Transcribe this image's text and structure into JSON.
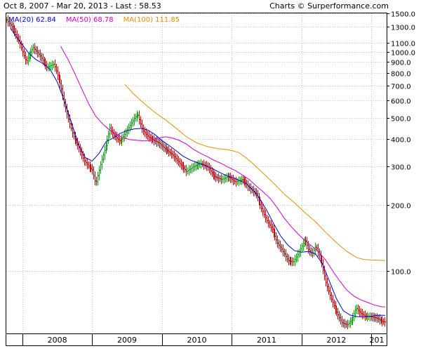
{
  "header": {
    "range_text": "Oct 8, 2007 - Mar 20, 2013 - Last : 58.53",
    "credit_text": "Charts © Surperformance.com"
  },
  "chart_data": {
    "type": "ohlc-weekly-bars-with-moving-averages",
    "title": "Oct 8, 2007 - Mar 20, 2013 - Last : 58.53",
    "y_scale": "log",
    "ylim": [
      52,
      1500
    ],
    "y_ticks": [
      1500,
      1300,
      1100,
      1000,
      900,
      800,
      700,
      600,
      500,
      400,
      300,
      200,
      100
    ],
    "y_tick_labels": [
      "1500.0",
      "1300.0",
      "1100.0",
      "1000.0",
      "900.0",
      "800.0",
      "700.0",
      "600.0",
      "500.0",
      "400.0",
      "300.0",
      "200.0",
      "100.0"
    ],
    "x_labels": [
      "2008",
      "2009",
      "2010",
      "2011",
      "2012",
      "201"
    ],
    "x_label_dates": [
      2008.0,
      2009.0,
      2010.0,
      2011.0,
      2012.0,
      2013.0
    ],
    "x_range": [
      2007.77,
      2013.22
    ],
    "grid": true,
    "legend": [
      {
        "name": "MA(20)",
        "value": "62.84",
        "color": "#0000cc"
      },
      {
        "name": "MA(50)",
        "value": "68.78",
        "color": "#cc00cc"
      },
      {
        "name": "MA(100)",
        "value": "111.85",
        "color": "#e09000"
      }
    ],
    "price_path": [
      [
        2007.77,
        1400
      ],
      [
        2007.85,
        1300
      ],
      [
        2007.95,
        1120
      ],
      [
        2008.05,
        900
      ],
      [
        2008.15,
        1050
      ],
      [
        2008.25,
        960
      ],
      [
        2008.35,
        850
      ],
      [
        2008.45,
        880
      ],
      [
        2008.55,
        700
      ],
      [
        2008.6,
        580
      ],
      [
        2008.65,
        500
      ],
      [
        2008.72,
        420
      ],
      [
        2008.8,
        370
      ],
      [
        2008.88,
        320
      ],
      [
        2008.95,
        300
      ],
      [
        2009.0,
        290
      ],
      [
        2009.05,
        250
      ],
      [
        2009.12,
        310
      ],
      [
        2009.2,
        380
      ],
      [
        2009.25,
        450
      ],
      [
        2009.3,
        420
      ],
      [
        2009.4,
        390
      ],
      [
        2009.5,
        440
      ],
      [
        2009.6,
        500
      ],
      [
        2009.65,
        520
      ],
      [
        2009.72,
        440
      ],
      [
        2009.8,
        410
      ],
      [
        2009.88,
        395
      ],
      [
        2009.95,
        385
      ],
      [
        2010.05,
        360
      ],
      [
        2010.15,
        340
      ],
      [
        2010.25,
        310
      ],
      [
        2010.35,
        285
      ],
      [
        2010.45,
        300
      ],
      [
        2010.55,
        310
      ],
      [
        2010.65,
        300
      ],
      [
        2010.75,
        270
      ],
      [
        2010.85,
        262
      ],
      [
        2010.95,
        270
      ],
      [
        2011.05,
        255
      ],
      [
        2011.15,
        262
      ],
      [
        2011.25,
        240
      ],
      [
        2011.35,
        225
      ],
      [
        2011.42,
        195
      ],
      [
        2011.5,
        170
      ],
      [
        2011.58,
        155
      ],
      [
        2011.65,
        135
      ],
      [
        2011.72,
        125
      ],
      [
        2011.8,
        112
      ],
      [
        2011.88,
        110
      ],
      [
        2011.95,
        120
      ],
      [
        2012.0,
        130
      ],
      [
        2012.05,
        140
      ],
      [
        2012.1,
        125
      ],
      [
        2012.15,
        120
      ],
      [
        2012.2,
        130
      ],
      [
        2012.28,
        112
      ],
      [
        2012.35,
        88
      ],
      [
        2012.42,
        75
      ],
      [
        2012.5,
        65
      ],
      [
        2012.58,
        58
      ],
      [
        2012.65,
        57
      ],
      [
        2012.72,
        60
      ],
      [
        2012.78,
        68
      ],
      [
        2012.85,
        64
      ],
      [
        2012.92,
        62
      ],
      [
        2013.0,
        62
      ],
      [
        2013.08,
        61
      ],
      [
        2013.15,
        59
      ],
      [
        2013.21,
        58.53
      ]
    ],
    "series": [
      {
        "name": "MA(20)",
        "values": [
          [
            2007.83,
            1280
          ],
          [
            2007.95,
            1130
          ],
          [
            2008.1,
            980
          ],
          [
            2008.2,
            920
          ],
          [
            2008.3,
            885
          ],
          [
            2008.4,
            830
          ],
          [
            2008.5,
            730
          ],
          [
            2008.6,
            600
          ],
          [
            2008.7,
            480
          ],
          [
            2008.8,
            380
          ],
          [
            2008.9,
            330
          ],
          [
            2009.0,
            318
          ],
          [
            2009.1,
            345
          ],
          [
            2009.2,
            390
          ],
          [
            2009.3,
            405
          ],
          [
            2009.4,
            425
          ],
          [
            2009.5,
            438
          ],
          [
            2009.6,
            445
          ],
          [
            2009.7,
            448
          ],
          [
            2009.8,
            440
          ],
          [
            2009.9,
            420
          ],
          [
            2010.0,
            395
          ],
          [
            2010.1,
            375
          ],
          [
            2010.2,
            355
          ],
          [
            2010.3,
            335
          ],
          [
            2010.4,
            322
          ],
          [
            2010.5,
            313
          ],
          [
            2010.6,
            305
          ],
          [
            2010.7,
            296
          ],
          [
            2010.8,
            285
          ],
          [
            2010.9,
            275
          ],
          [
            2011.0,
            268
          ],
          [
            2011.1,
            260
          ],
          [
            2011.2,
            252
          ],
          [
            2011.3,
            235
          ],
          [
            2011.4,
            215
          ],
          [
            2011.5,
            190
          ],
          [
            2011.6,
            165
          ],
          [
            2011.7,
            145
          ],
          [
            2011.8,
            132
          ],
          [
            2011.9,
            124
          ],
          [
            2012.0,
            122
          ],
          [
            2012.1,
            123
          ],
          [
            2012.2,
            120
          ],
          [
            2012.3,
            108
          ],
          [
            2012.4,
            90
          ],
          [
            2012.5,
            75
          ],
          [
            2012.6,
            66
          ],
          [
            2012.7,
            63
          ],
          [
            2012.8,
            62
          ],
          [
            2012.9,
            62
          ],
          [
            2013.0,
            62.3
          ],
          [
            2013.1,
            63
          ],
          [
            2013.2,
            62.84
          ]
        ]
      },
      {
        "name": "MA(50)",
        "values": [
          [
            2008.55,
            1060
          ],
          [
            2008.65,
            930
          ],
          [
            2008.75,
            800
          ],
          [
            2008.85,
            680
          ],
          [
            2008.95,
            580
          ],
          [
            2009.05,
            510
          ],
          [
            2009.15,
            470
          ],
          [
            2009.25,
            440
          ],
          [
            2009.35,
            420
          ],
          [
            2009.45,
            405
          ],
          [
            2009.55,
            398
          ],
          [
            2009.65,
            395
          ],
          [
            2009.75,
            393
          ],
          [
            2009.85,
            396
          ],
          [
            2009.95,
            405
          ],
          [
            2010.05,
            410
          ],
          [
            2010.15,
            405
          ],
          [
            2010.25,
            395
          ],
          [
            2010.35,
            380
          ],
          [
            2010.45,
            360
          ],
          [
            2010.55,
            345
          ],
          [
            2010.65,
            333
          ],
          [
            2010.75,
            320
          ],
          [
            2010.85,
            310
          ],
          [
            2010.95,
            298
          ],
          [
            2011.05,
            288
          ],
          [
            2011.15,
            275
          ],
          [
            2011.25,
            262
          ],
          [
            2011.35,
            245
          ],
          [
            2011.45,
            230
          ],
          [
            2011.55,
            215
          ],
          [
            2011.65,
            195
          ],
          [
            2011.75,
            175
          ],
          [
            2011.85,
            160
          ],
          [
            2011.95,
            148
          ],
          [
            2012.05,
            138
          ],
          [
            2012.15,
            130
          ],
          [
            2012.25,
            122
          ],
          [
            2012.35,
            112
          ],
          [
            2012.45,
            100
          ],
          [
            2012.55,
            90
          ],
          [
            2012.65,
            82
          ],
          [
            2012.75,
            77
          ],
          [
            2012.85,
            74
          ],
          [
            2012.95,
            72
          ],
          [
            2013.05,
            70
          ],
          [
            2013.15,
            68.8
          ],
          [
            2013.2,
            68.78
          ]
        ]
      },
      {
        "name": "MA(100)",
        "values": [
          [
            2009.47,
            710
          ],
          [
            2009.6,
            640
          ],
          [
            2009.75,
            580
          ],
          [
            2009.9,
            530
          ],
          [
            2010.05,
            490
          ],
          [
            2010.2,
            450
          ],
          [
            2010.35,
            410
          ],
          [
            2010.5,
            385
          ],
          [
            2010.65,
            370
          ],
          [
            2010.8,
            362
          ],
          [
            2010.95,
            358
          ],
          [
            2011.1,
            348
          ],
          [
            2011.2,
            330
          ],
          [
            2011.3,
            310
          ],
          [
            2011.45,
            280
          ],
          [
            2011.6,
            252
          ],
          [
            2011.75,
            225
          ],
          [
            2011.9,
            205
          ],
          [
            2012.05,
            185
          ],
          [
            2012.2,
            168
          ],
          [
            2012.35,
            150
          ],
          [
            2012.5,
            135
          ],
          [
            2012.65,
            123
          ],
          [
            2012.8,
            115
          ],
          [
            2012.9,
            113
          ],
          [
            2013.0,
            112.5
          ],
          [
            2013.2,
            111.85
          ]
        ]
      }
    ]
  }
}
